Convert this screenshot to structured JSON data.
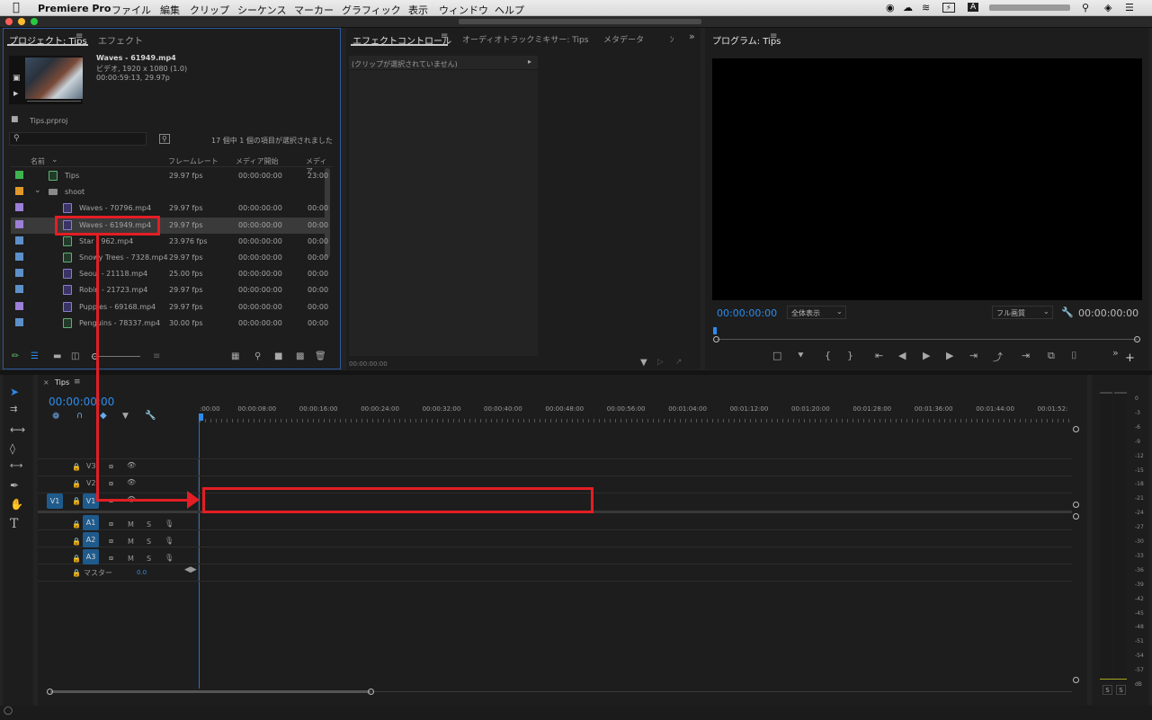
{
  "menubar": {
    "app": "Premiere Pro",
    "items": [
      "ファイル",
      "編集",
      "クリップ",
      "シーケンス",
      "マーカー",
      "グラフィック",
      "表示",
      "ウィンドウ",
      "ヘルプ"
    ]
  },
  "project": {
    "tab_label": "プロジェクト: Tips",
    "tab2_label": "エフェクト",
    "preview_name": "Waves - 61949.mp4",
    "preview_info1": "ビデオ, 1920 x 1080 (1.0)",
    "preview_info2": "00:00:59:13, 29.97p",
    "project_file": "Tips.prproj",
    "search_placeholder": "",
    "selection_status": "17 個中 1 個の項目が選択されました",
    "columns": [
      "名前",
      "フレームレート",
      "メディア開始",
      "メディア"
    ],
    "rows": [
      {
        "name": "Tips",
        "fps": "29.97 fps",
        "start": "00:00:00:00",
        "end": "23:00",
        "color": "#3fb34f",
        "type": "seq"
      },
      {
        "name": "shoot",
        "fps": "",
        "start": "",
        "end": "",
        "color": "#e0982a",
        "type": "folder"
      },
      {
        "name": "Waves - 70796.mp4",
        "fps": "29.97 fps",
        "start": "00:00:00:00",
        "end": "00:00",
        "color": "#9c7fd6",
        "type": "video"
      },
      {
        "name": "Waves - 61949.mp4",
        "fps": "29.97 fps",
        "start": "00:00:00:00",
        "end": "00:00",
        "color": "#9c7fd6",
        "type": "video"
      },
      {
        "name": "Star - 962.mp4",
        "fps": "23.976 fps",
        "start": "00:00:00:00",
        "end": "00:00",
        "color": "#5d8fc8",
        "type": "av"
      },
      {
        "name": "Snowy Trees - 7328.mp4",
        "fps": "29.97 fps",
        "start": "00:00:00:00",
        "end": "00:00",
        "color": "#5d8fc8",
        "type": "av"
      },
      {
        "name": "Seoul - 21118.mp4",
        "fps": "25.00 fps",
        "start": "00:00:00:00",
        "end": "00:00",
        "color": "#5d8fc8",
        "type": "video"
      },
      {
        "name": "Robin - 21723.mp4",
        "fps": "29.97 fps",
        "start": "00:00:00:00",
        "end": "00:00",
        "color": "#5d8fc8",
        "type": "video"
      },
      {
        "name": "Puppies - 69168.mp4",
        "fps": "29.97 fps",
        "start": "00:00:00:00",
        "end": "00:00",
        "color": "#9c7fd6",
        "type": "video"
      },
      {
        "name": "Penguins - 78337.mp4",
        "fps": "30.00 fps",
        "start": "00:00:00:00",
        "end": "00:00",
        "color": "#5d8fc8",
        "type": "av"
      }
    ]
  },
  "effects": {
    "tab_label": "エフェクトコントロール",
    "tab2_label": "オーディオトラックミキサー: Tips",
    "tab3_label": "メタデータ",
    "tab4_label": "ﾝ",
    "no_clip": "(クリップが選択されていません)",
    "timecode": "00:00:00:00"
  },
  "program": {
    "tab_label": "プログラム: Tips",
    "timecode_left": "00:00:00:00",
    "fit_label": "全体表示",
    "quality_label": "フル画質",
    "timecode_right": "00:00:00:00"
  },
  "timeline": {
    "tab_label": "Tips",
    "timecode": "00:00:00:00",
    "ticks": [
      ":00:00",
      "00:00:08:00",
      "00:00:16:00",
      "00:00:24:00",
      "00:00:32:00",
      "00:00:40:00",
      "00:00:48:00",
      "00:00:56:00",
      "00:01:04:00",
      "00:01:12:00",
      "00:01:20:00",
      "00:01:28:00",
      "00:01:36:00",
      "00:01:44:00",
      "00:01:52:"
    ],
    "video_tracks": [
      "V3",
      "V2",
      "V1"
    ],
    "audio_tracks": [
      "A1",
      "A2",
      "A3"
    ],
    "source_patch": "V1",
    "master_label": "マスター",
    "master_value": "0.0",
    "mute_label": "M",
    "solo_label": "S"
  },
  "meter": {
    "scale": [
      "0",
      "-3",
      "-6",
      "-9",
      "-12",
      "-15",
      "-18",
      "-21",
      "-24",
      "-27",
      "-30",
      "-33",
      "-36",
      "-39",
      "-42",
      "-45",
      "-48",
      "-51",
      "-54",
      "-57",
      "dB"
    ],
    "solo_labels": [
      "S",
      "S"
    ]
  },
  "colors": {
    "accent": "#2d8ceb",
    "annotation": "#e31e24",
    "panel_bg": "#1d1d1d"
  }
}
